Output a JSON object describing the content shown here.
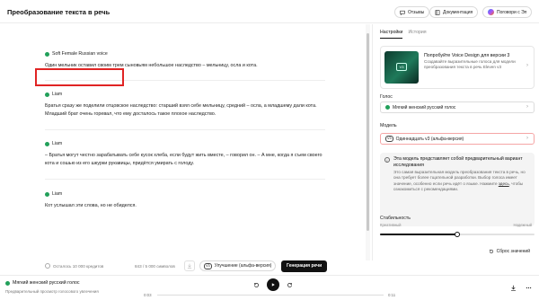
{
  "header": {
    "title": "Преобразование текста в речь",
    "feedback_label": "Отзывы",
    "docs_label": "Документация",
    "talk_label": "Поговори с Эл"
  },
  "editor": {
    "blocks": [
      {
        "voice": "Soft Female Russian voice",
        "text": "Один мельник оставил своим трем сыновьям небольшое наследство – мельницу, осла и кота."
      },
      {
        "voice": "Liam",
        "text": "Братья сразу же поделили отцовское наследство: старший взял себе мельницу, средний – осла, а младшему дали кота. Младший брат очень горевал, что ему досталось такое плохое наследство."
      },
      {
        "voice": "Liam",
        "text": "– Братья могут честно зарабатывать себе кусок хлеба, если будут жить вместе, – говорил он. – А мне, когда я съем своего кота и сошью из его шкурки рукавицы, придётся умирать с голоду."
      },
      {
        "voice": "Liam",
        "text": "Кот услышал эти слова, но не обиделся."
      }
    ],
    "credits": "Осталось 10 000 кредитов",
    "char_count": "843 / 5 000 символов",
    "model_badge": "V3",
    "model_label": "Улучшение (альфа-версия)",
    "generate_label": "Генерация речи"
  },
  "panel": {
    "tabs": [
      {
        "label": "Настройки",
        "active": true
      },
      {
        "label": "История",
        "active": false
      }
    ],
    "promo": {
      "badge": "V3",
      "title": "Попробуйте Voice Design для версии 3",
      "text": "Создавайте выразительные голоса для модели преобразования текста в речь Eleven v3"
    },
    "voice_label": "Голос",
    "voice_value": "Мягкий женский русский голос",
    "model_label": "Модель",
    "model_badge": "V3",
    "model_value": "Одиннадцать v3 (альфа-версия)",
    "info": {
      "title": "Эта модель представляет собой предварительный вариант исследования",
      "text": "Это самая выразительная модель преобразования текста в речь, но она требует более тщательной разработки. Выбор голоса имеет значение, особенно если речь идёт о языке. Нажмите",
      "link": "здесь",
      "text_end": ", чтобы ознакомиться с рекомендациями."
    },
    "stability": {
      "label": "Стабильность",
      "min_label": "Креативный",
      "max_label": "Надежный",
      "value": 0.5
    },
    "reset_label": "Сброс значений"
  },
  "player": {
    "voice": "Мягкий женский русский голос",
    "subtitle": "Предварительный просмотр голосового увлечения",
    "time_current": "0:03",
    "time_total": "0:11"
  },
  "colors": {
    "voice_dot": "#22a05a",
    "highlight": "#e02424",
    "accent": "#111111"
  }
}
